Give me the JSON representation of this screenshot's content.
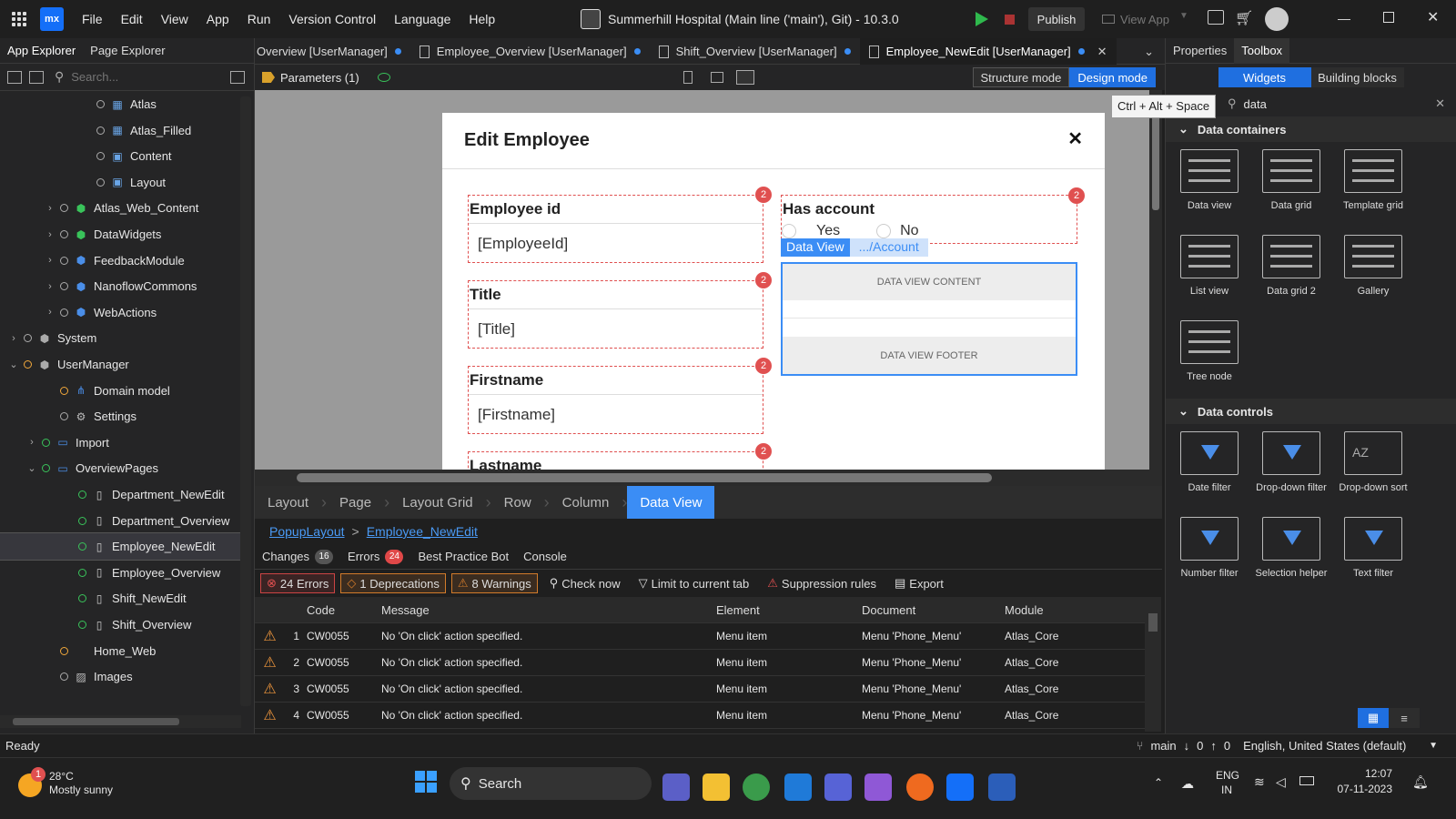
{
  "menu": {
    "logo": "mx",
    "items": [
      "File",
      "Edit",
      "View",
      "App",
      "Run",
      "Version Control",
      "Language",
      "Help"
    ]
  },
  "app_title": "Summerhill Hospital (Main line ('main'), Git)  -  10.3.0",
  "toolbar": {
    "publish": "Publish",
    "view_app": "View App"
  },
  "left_panel": {
    "tabs": [
      "App Explorer",
      "Page Explorer"
    ],
    "search_placeholder": "Search...",
    "tree": [
      {
        "label": "Atlas",
        "indent": 5,
        "icon": "layout",
        "dot": "grey",
        "chev": ""
      },
      {
        "label": "Atlas_Filled",
        "indent": 5,
        "icon": "layout",
        "dot": "grey",
        "chev": ""
      },
      {
        "label": "Content",
        "indent": 5,
        "icon": "layout-content",
        "dot": "grey",
        "chev": ""
      },
      {
        "label": "Layout",
        "indent": 5,
        "icon": "layout-content",
        "dot": "grey",
        "chev": ""
      },
      {
        "label": "Atlas_Web_Content",
        "indent": 3,
        "icon": "module-green",
        "dot": "grey",
        "chev": ">"
      },
      {
        "label": "DataWidgets",
        "indent": 3,
        "icon": "module-green",
        "dot": "grey",
        "chev": ">"
      },
      {
        "label": "FeedbackModule",
        "indent": 3,
        "icon": "module-blue",
        "dot": "grey",
        "chev": ">"
      },
      {
        "label": "NanoflowCommons",
        "indent": 3,
        "icon": "module-blue",
        "dot": "grey",
        "chev": ">"
      },
      {
        "label": "WebActions",
        "indent": 3,
        "icon": "module-blue",
        "dot": "grey",
        "chev": ">"
      },
      {
        "label": "System",
        "indent": 1,
        "icon": "module-grey",
        "dot": "grey",
        "chev": ">"
      },
      {
        "label": "UserManager",
        "indent": 1,
        "icon": "module-grey",
        "dot": "orange",
        "chev": "v"
      },
      {
        "label": "Domain model",
        "indent": 3,
        "icon": "domain-model",
        "dot": "orange",
        "chev": ""
      },
      {
        "label": "Settings",
        "indent": 3,
        "icon": "settings",
        "dot": "grey",
        "chev": ""
      },
      {
        "label": "Import",
        "indent": 2,
        "icon": "folder",
        "dot": "green",
        "chev": ">"
      },
      {
        "label": "OverviewPages",
        "indent": 2,
        "icon": "folder",
        "dot": "green",
        "chev": "v"
      },
      {
        "label": "Department_NewEdit",
        "indent": 4,
        "icon": "page",
        "dot": "green",
        "chev": ""
      },
      {
        "label": "Department_Overview",
        "indent": 4,
        "icon": "page",
        "dot": "green",
        "chev": ""
      },
      {
        "label": "Employee_NewEdit",
        "indent": 4,
        "icon": "page",
        "dot": "green",
        "chev": "",
        "selected": true
      },
      {
        "label": "Employee_Overview",
        "indent": 4,
        "icon": "page",
        "dot": "green",
        "chev": ""
      },
      {
        "label": "Shift_NewEdit",
        "indent": 4,
        "icon": "page",
        "dot": "green",
        "chev": ""
      },
      {
        "label": "Shift_Overview",
        "indent": 4,
        "icon": "page",
        "dot": "green",
        "chev": ""
      },
      {
        "label": "Home_Web",
        "indent": 3,
        "icon": "",
        "dot": "orange",
        "chev": ""
      },
      {
        "label": "Images",
        "indent": 3,
        "icon": "images",
        "dot": "grey",
        "chev": ""
      }
    ]
  },
  "doc_tabs": [
    {
      "label": "Overview [UserManager]",
      "active": false,
      "icon": false
    },
    {
      "label": "Employee_Overview [UserManager]",
      "active": false,
      "icon": true
    },
    {
      "label": "Shift_Overview [UserManager]",
      "active": false,
      "icon": true
    },
    {
      "label": "Employee_NewEdit [UserManager]",
      "active": true,
      "icon": true
    }
  ],
  "editor_toolbar": {
    "parameters": "Parameters (1)",
    "structure_mode": "Structure mode",
    "design_mode": "Design mode"
  },
  "popup": {
    "title": "Edit Employee",
    "close": "✕",
    "fields": [
      {
        "label": "Employee id",
        "value": "[EmployeeId]",
        "badge": "2"
      },
      {
        "label": "Title",
        "value": "[Title]",
        "badge": "2"
      },
      {
        "label": "Firstname",
        "value": "[Firstname]",
        "badge": "2"
      },
      {
        "label": "Lastname",
        "value": "",
        "badge": "2"
      }
    ],
    "has_account": {
      "label": "Has account",
      "yes": "Yes",
      "no": "No",
      "badge": "2"
    },
    "dataview": {
      "tag": "Data View",
      "path": ".../Account",
      "content": "DATA VIEW CONTENT",
      "footer": "DATA VIEW FOOTER"
    }
  },
  "breadcrumb": [
    "Layout",
    "Page",
    "Layout Grid",
    "Row",
    "Column",
    "Data View"
  ],
  "path": {
    "layout": "PopupLayout",
    "sep": ">",
    "page": "Employee_NewEdit"
  },
  "bottom_tabs": [
    {
      "label": "Changes",
      "count": "16"
    },
    {
      "label": "Errors",
      "count": "24"
    },
    {
      "label": "Best Practice Bot",
      "count": ""
    },
    {
      "label": "Console",
      "count": ""
    }
  ],
  "error_toolbar": {
    "errors": "24 Errors",
    "deprecations": "1 Deprecations",
    "warnings": "8 Warnings",
    "check_now": "Check now",
    "limit": "Limit to current tab",
    "suppression": "Suppression rules",
    "export": "Export"
  },
  "error_table": {
    "headers": [
      "Code",
      "Message",
      "Element",
      "Document",
      "Module"
    ],
    "rows": [
      [
        "1",
        "CW0055",
        "No 'On click' action specified.",
        "Menu item",
        "Menu 'Phone_Menu'",
        "Atlas_Core"
      ],
      [
        "2",
        "CW0055",
        "No 'On click' action specified.",
        "Menu item",
        "Menu 'Phone_Menu'",
        "Atlas_Core"
      ],
      [
        "3",
        "CW0055",
        "No 'On click' action specified.",
        "Menu item",
        "Menu 'Phone_Menu'",
        "Atlas_Core"
      ],
      [
        "4",
        "CW0055",
        "No 'On click' action specified.",
        "Menu item",
        "Menu 'Phone_Menu'",
        "Atlas_Core"
      ]
    ]
  },
  "right_panel": {
    "tabs": [
      "Properties",
      "Toolbox"
    ],
    "sub_tabs": [
      "Widgets",
      "Building blocks"
    ],
    "search_value": "data",
    "tooltip": "Ctrl + Alt + Space",
    "sections": [
      "Data containers",
      "Data controls"
    ],
    "containers": [
      "Data view",
      "Data grid",
      "Template grid",
      "List view",
      "Data grid 2",
      "Gallery",
      "Tree node"
    ],
    "controls": [
      "Date filter",
      "Drop-down filter",
      "Drop-down sort",
      "Number filter",
      "Selection helper",
      "Text filter"
    ],
    "sort_label": "AZ"
  },
  "status": {
    "ready": "Ready",
    "branch": "main",
    "down": "0",
    "up": "0",
    "language": "English, United States (default)"
  },
  "taskbar": {
    "weather_temp": "28°C",
    "weather_desc": "Mostly sunny",
    "weather_badge": "1",
    "search": "Search",
    "lang": "ENG",
    "lang2": "IN",
    "time": "12:07",
    "date": "07-11-2023"
  },
  "colors": {
    "accent": "#3b8df5",
    "error": "#e05050",
    "green": "#39c35a",
    "orange": "#f1a83b"
  }
}
